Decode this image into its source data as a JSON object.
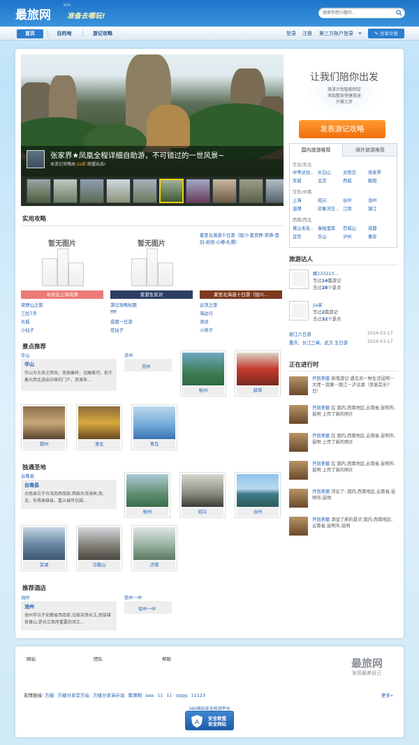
{
  "header": {
    "logo": "最旅网",
    "beta": "BETA",
    "slogan": "准备去哪玩!",
    "search_placeholder": "搜索你感兴趣的..."
  },
  "nav": {
    "items": [
      "首页",
      "目的地",
      "游记攻略"
    ],
    "right": [
      "登录",
      "注册",
      "第三方账户登录"
    ],
    "share": "分享计划"
  },
  "hero": {
    "title": "张家界★凤凰全程详细自助游，不可错过的一世风景~",
    "sub_prefix": "本游记攻略由",
    "sub_user": "jia家",
    "sub_suffix": "原盟出品!"
  },
  "promo": {
    "title": "让我们陪你出发",
    "lines": [
      "旅游计划智能制定",
      "添加整条快捷旅途",
      "只需三步"
    ],
    "button": "发表游记攻略"
  },
  "tabs": {
    "labels": [
      "国内旅游推荐",
      "境外旅游推荐"
    ],
    "regions": [
      {
        "name": "华北/东北",
        "cities": [
          "中等达拉..",
          "长白山",
          "太阳岛",
          "张家界",
          "东城",
          "北京",
          "西城",
          "朝阳"
        ]
      },
      {
        "name": "华东/中南",
        "cities": [
          "上海",
          "绍兴",
          "台州",
          "池州",
          "淄博",
          "印象浏王..",
          "江阴",
          "镇江",
          "瓦岛",
          "朱家尖",
          "天目山",
          "连云港",
          "天空之城",
          "下沙",
          "长岛",
          "嵊泗"
        ]
      },
      {
        "name": "西南/西北",
        "cities": [
          "黄山毛毛..",
          "泰拍里库",
          "百城山",
          "成都",
          "宜宾",
          "乐山",
          "泸州",
          "雅安"
        ]
      }
    ]
  },
  "practical": {
    "title": "实用攻略",
    "noimg": "暂无图片",
    "cols": [
      {
        "band": "寻找北上海风情",
        "links": [
          "梁野山之旅",
          "三拉7天",
          "长城",
          "小仙子"
        ]
      },
      {
        "band": "爱游生反对",
        "links": [
          "游记攻略标题",
          "ffff",
          "成都一日游",
          "花仙子"
        ]
      },
      {
        "band": "夏至北海道十日游（旭川...",
        "head": "夏至北海道十日游（旭川-富良野-美瑛-登别-函馆-小樽-札幌）",
        "links": [
          "云顶之旅",
          "海边行",
          "测试",
          "小燕子"
        ]
      }
    ]
  },
  "scenic": {
    "title": "景点推荐",
    "feature": {
      "region": "华山",
      "name": "华山",
      "desc": "华山为五岳之西岳，南接秦岭，北瞰黄河，扼守着大西北进出中原的门户，资源丰..."
    },
    "second_region": "苏州",
    "second_card": "苏州",
    "photos": [
      "杭州",
      "蚌埠",
      "滁州",
      "淮北",
      "青岛"
    ]
  },
  "unique": {
    "title": "独遇圣地",
    "feature": {
      "region": "台南县",
      "name": "台南县",
      "desc": "台南县位于台湾岛西南部,西临台湾海峡,南、北、东界高雄县、嘉义县所包围..."
    },
    "photos": [
      "杭州",
      "绍兴",
      "台州",
      "芜湖",
      "马鞍山",
      "济南"
    ]
  },
  "hotel": {
    "title": "推荐酒店",
    "feature": {
      "region": "池州",
      "name": "池州",
      "desc": "池州市位于安徽省西南部,北临浩荡长江,南接雄奇黄山,是长江南岸重要的滨江..."
    },
    "second_region": "徐州一中",
    "second_card": "徐州一中"
  },
  "talents": {
    "title": "旅游达人",
    "people": [
      {
        "name": "瞧233223...",
        "notes": "14",
        "spots": "28",
        "l1": "写过",
        "l1b": "篇游记",
        "l2": "去过",
        "l2b": "个景点"
      },
      {
        "name": "jia家",
        "notes": "2",
        "spots": "32",
        "l1": "写过",
        "l1b": "篇游记",
        "l2": "去过",
        "l2b": "个景点"
      }
    ],
    "recent": [
      {
        "text": "丽江六日游",
        "date": "2014-03-17"
      },
      {
        "text": "重庆、长江三峡、武汉 五日游",
        "date": "2014-03-17"
      }
    ]
  },
  "live": {
    "title": "正在进行时",
    "items": [
      {
        "user": "开到荼靡",
        "text": "新增游记 遇见另一种生活昆明－大理－双廊－丽江－泸沽湖（圣诞完全7日）"
      },
      {
        "user": "开到荼靡",
        "text": "在 国内,西南地区,云南省,昆明市,昆明 上传了新的照片"
      },
      {
        "user": "开到荼靡",
        "text": "在 国内,西南地区,云南省,昆明市,昆明 上传了新的照片"
      },
      {
        "user": "开到荼靡",
        "text": "在 国内,西南地区,云南省,昆明市,昆明 上传了新的照片"
      },
      {
        "user": "开到荼靡",
        "text": "评论了: 国内,西南地区,云南省,昆明市,昆明"
      },
      {
        "user": "开到荼靡",
        "text": "添加了新的景点 国内,西南地区,云南省,昆明市,昆明"
      }
    ]
  },
  "footer": {
    "cols": [
      "网站",
      "团队",
      "帮助"
    ],
    "logo": "最旅网",
    "slogan": "发现最美自己",
    "links_label": "友情链接:",
    "links": [
      "方缝",
      "方缝分享官方站",
      "方缝分享演示站",
      "聚源网",
      "aaa",
      "11",
      "11",
      "qqqq",
      "11123"
    ],
    "more": "更多»",
    "cert_title": "360网站安全检测平台",
    "cert_lines": [
      "安全联盟",
      "安全网站"
    ]
  }
}
